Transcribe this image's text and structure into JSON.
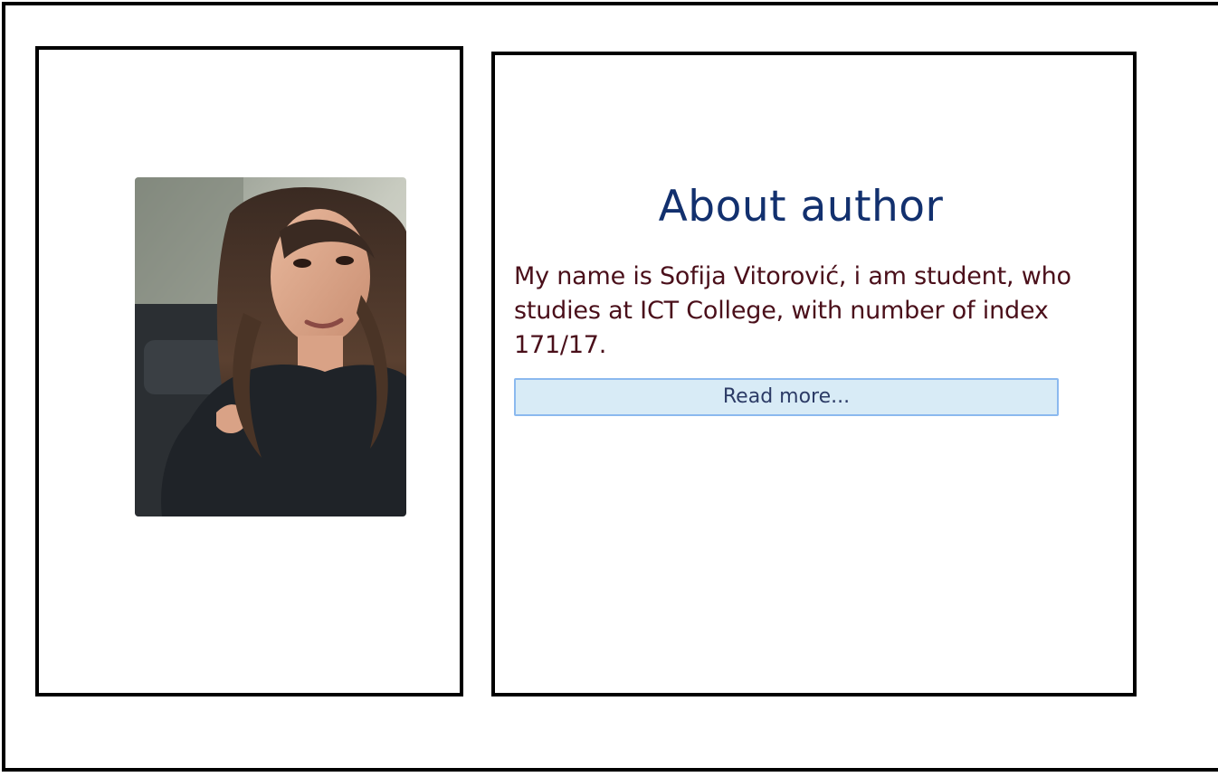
{
  "about": {
    "title": "About author",
    "description": "My name is Sofija Vitorović, i am student, who studies at ICT College, with number of index 171/17.",
    "read_more_label": "Read more..."
  },
  "photo": {
    "description_icon": "author-portrait-photo"
  },
  "colors": {
    "title": "#12306e",
    "text": "#4a0f1a",
    "button_bg": "#d8ebf6",
    "button_border": "#8bb9ef",
    "button_text": "#2c3b66",
    "frame": "#000000"
  }
}
